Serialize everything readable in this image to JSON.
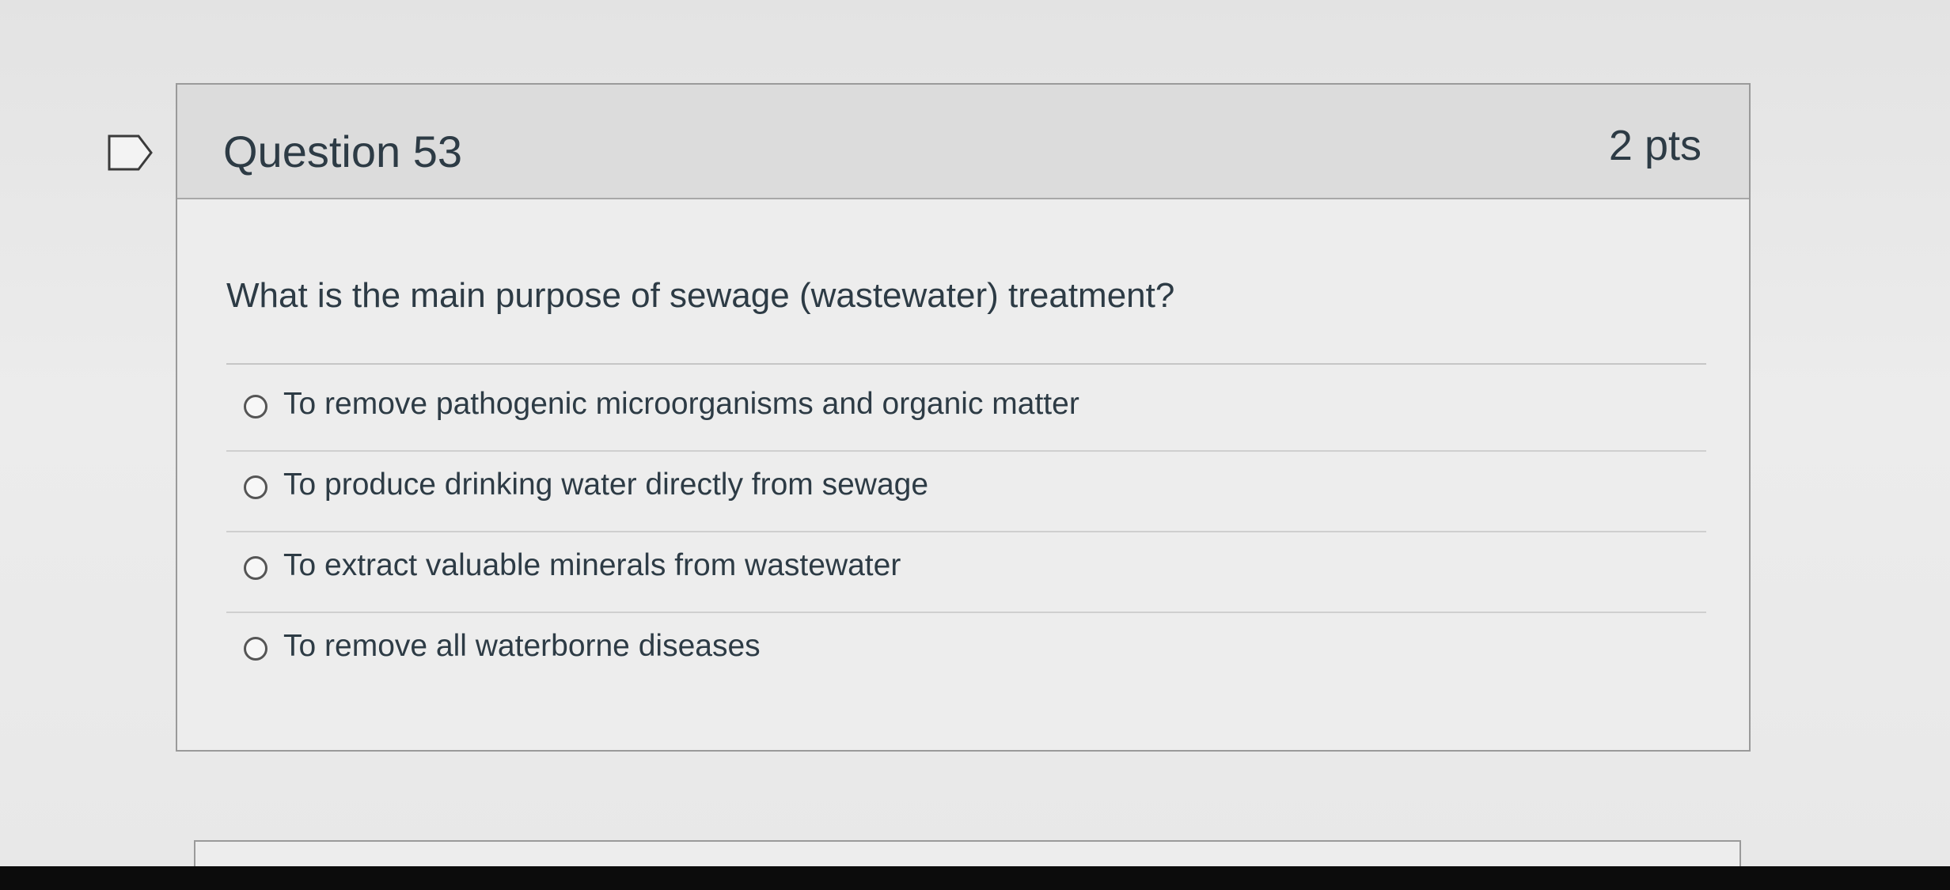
{
  "question": {
    "title": "Question 53",
    "points": "2 pts",
    "text": "What is the main purpose of sewage (wastewater) treatment?",
    "bookmark_icon": "bookmark-flag-icon"
  },
  "answers": [
    {
      "label": "To remove pathogenic microorganisms and organic matter"
    },
    {
      "label": "To produce drinking water directly from sewage"
    },
    {
      "label": "To extract valuable minerals from wastewater"
    },
    {
      "label": "To remove all waterborne diseases"
    }
  ],
  "colors": {
    "text": "#2d3b45",
    "header_bg": "#dcdcdc",
    "border": "#9a9a9a"
  }
}
